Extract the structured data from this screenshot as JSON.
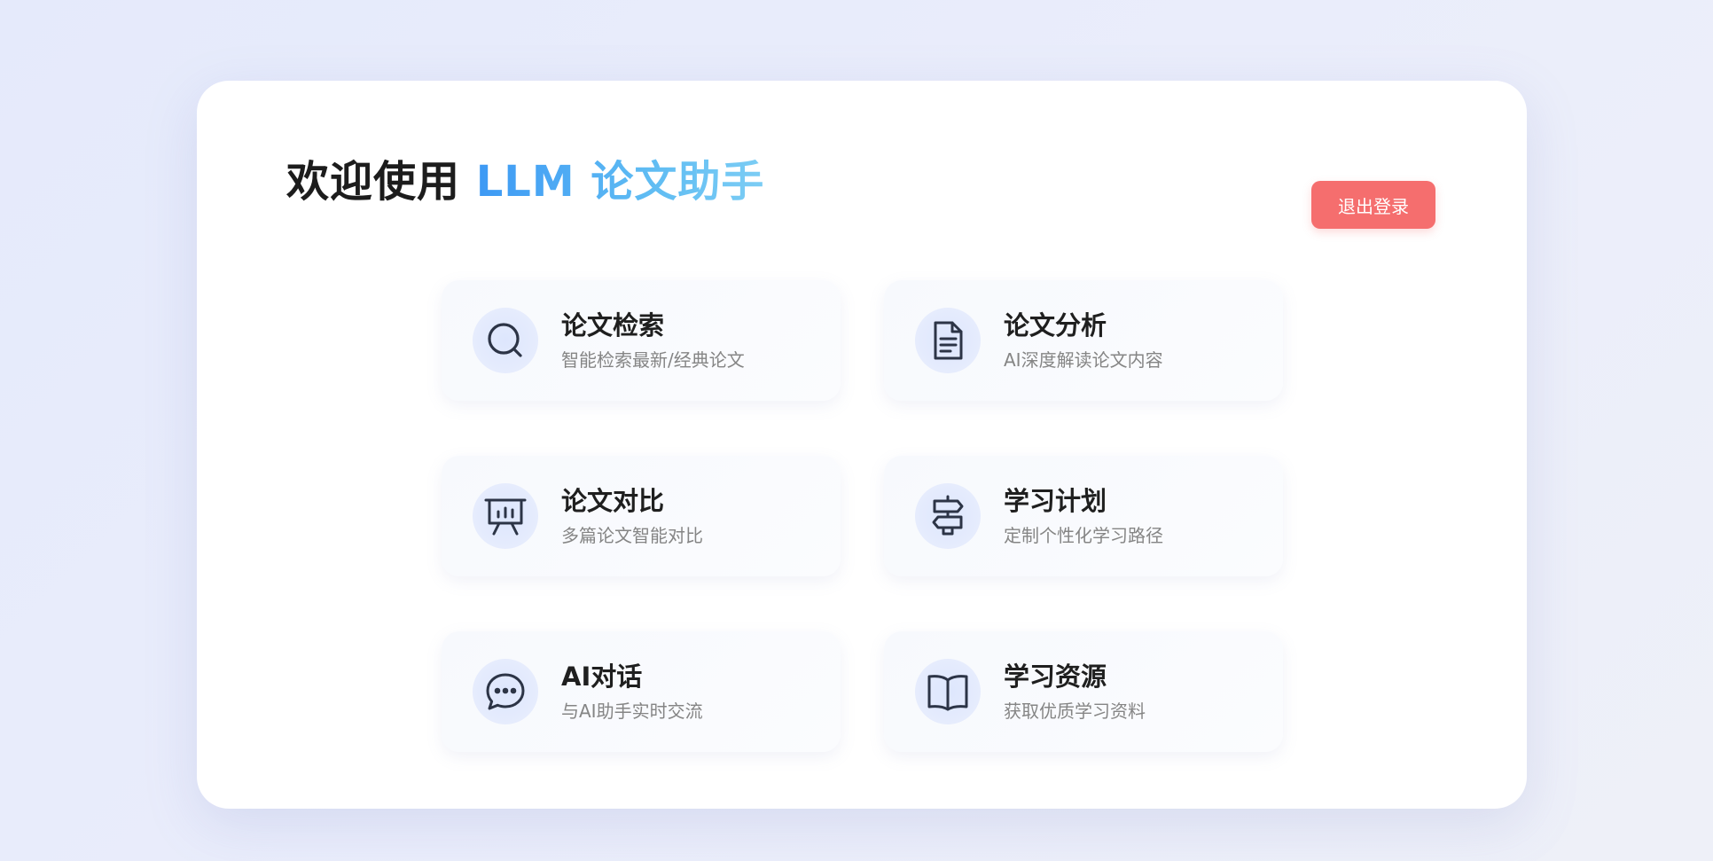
{
  "header": {
    "title_prefix": "欢迎使用 ",
    "title_accent": "LLM 论文助手",
    "logout_label": "退出登录"
  },
  "colors": {
    "accent_gradient_start": "#3d99f4",
    "accent_gradient_end": "#7ccdf4",
    "logout_button": "#f56e6e",
    "icon_stroke": "#2c3446"
  },
  "features": [
    {
      "icon": "search-icon",
      "title": "论文检索",
      "desc": "智能检索最新/经典论文"
    },
    {
      "icon": "document-icon",
      "title": "论文分析",
      "desc": "AI深度解读论文内容"
    },
    {
      "icon": "presentation-chart-icon",
      "title": "论文对比",
      "desc": "多篇论文智能对比"
    },
    {
      "icon": "signpost-icon",
      "title": "学习计划",
      "desc": "定制个性化学习路径"
    },
    {
      "icon": "chat-bubble-icon",
      "title": "AI对话",
      "desc": "与AI助手实时交流"
    },
    {
      "icon": "open-book-icon",
      "title": "学习资源",
      "desc": "获取优质学习资料"
    }
  ]
}
